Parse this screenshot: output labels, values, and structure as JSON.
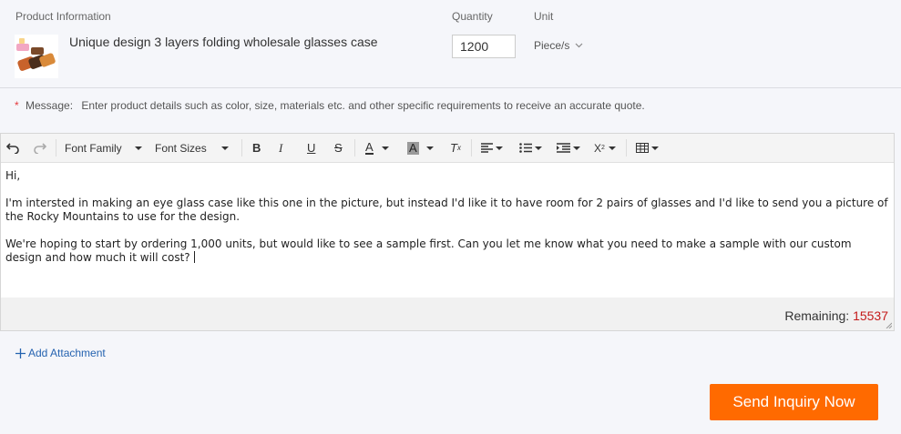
{
  "product": {
    "header_info": "Product Information",
    "header_quantity": "Quantity",
    "header_unit": "Unit",
    "name": "Unique design 3 layers folding wholesale glasses case",
    "quantity": "1200",
    "unit": "Piece/s"
  },
  "message": {
    "required_mark": "*",
    "label": "Message:",
    "hint": "Enter product details such as color, size, materials etc. and other specific requirements to receive an accurate quote."
  },
  "toolbar": {
    "font_family": "Font Family",
    "font_sizes": "Font Sizes",
    "bold": "B",
    "italic": "I",
    "underline": "U",
    "strike": "S",
    "font_color": "A",
    "bg_color": "A",
    "clear_format": "T",
    "clear_format_sub": "x",
    "subscript": "X",
    "subscript_sub": "2"
  },
  "editor": {
    "line1": "Hi,",
    "para2": "I'm intersted in making an eye glass case like this one in the picture, but instead I'd like it to have room for 2 pairs of glasses and I'd like to send you a picture of the Rocky Mountains to use for the design.",
    "para3": "We're hoping to start by ordering 1,000 units, but would like to see a sample first. Can you let me know what you need to make a sample with our custom design and how much it will cost?",
    "remaining_label": "Remaining:",
    "remaining_value": "15537"
  },
  "actions": {
    "add_attachment": "Add Attachment",
    "send_inquiry": "Send Inquiry Now"
  },
  "colors": {
    "accent": "#ff6a00",
    "link": "#2563b0",
    "remaining": "#c41a1a"
  }
}
